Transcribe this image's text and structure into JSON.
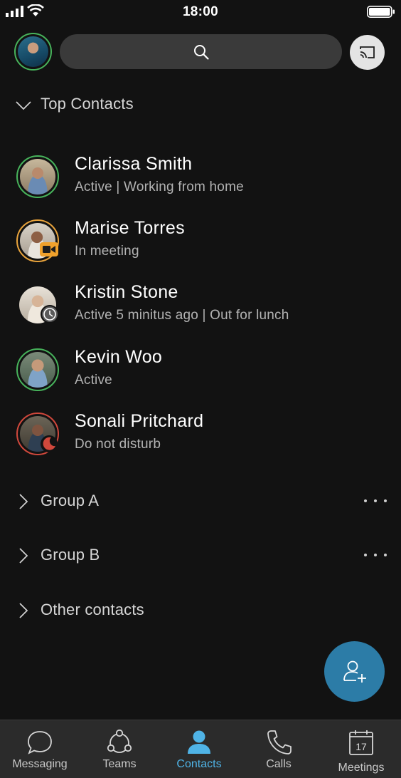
{
  "status_bar": {
    "time": "18:00"
  },
  "search": {
    "icon": "search-icon"
  },
  "top_contacts": {
    "label": "Top Contacts",
    "contacts": [
      {
        "name": "Clarissa Smith",
        "status": "Active | Working from home",
        "presence": "active",
        "ring_color": "#47b35b"
      },
      {
        "name": "Marise Torres",
        "status": "In meeting",
        "presence": "in-meeting",
        "ring_color": "#e8a33c"
      },
      {
        "name": "Kristin Stone",
        "status": "Active 5 minitus ago | Out for lunch",
        "presence": "away",
        "ring_color": "#8a8a8a"
      },
      {
        "name": "Kevin Woo",
        "status": "Active",
        "presence": "active",
        "ring_color": "#47b35b"
      },
      {
        "name": "Sonali Pritchard",
        "status": "Do not disturb",
        "presence": "dnd",
        "ring_color": "#d0483c"
      }
    ]
  },
  "groups": [
    {
      "label": "Group A",
      "has_menu": true
    },
    {
      "label": "Group B",
      "has_menu": true
    },
    {
      "label": "Other contacts",
      "has_menu": false
    }
  ],
  "nav": {
    "items": [
      {
        "label": "Messaging",
        "icon": "chat-bubble-icon",
        "active": false
      },
      {
        "label": "Teams",
        "icon": "teams-icon",
        "active": false
      },
      {
        "label": "Contacts",
        "icon": "person-icon",
        "active": true
      },
      {
        "label": "Calls",
        "icon": "phone-icon",
        "active": false
      },
      {
        "label": "Meetings",
        "icon": "calendar-icon",
        "active": false,
        "calendar_day": "17"
      }
    ]
  },
  "colors": {
    "accent": "#4fb3e6",
    "fab": "#2c7ca7",
    "active": "#47b35b",
    "meeting": "#e8a33c",
    "dnd": "#d0483c"
  }
}
